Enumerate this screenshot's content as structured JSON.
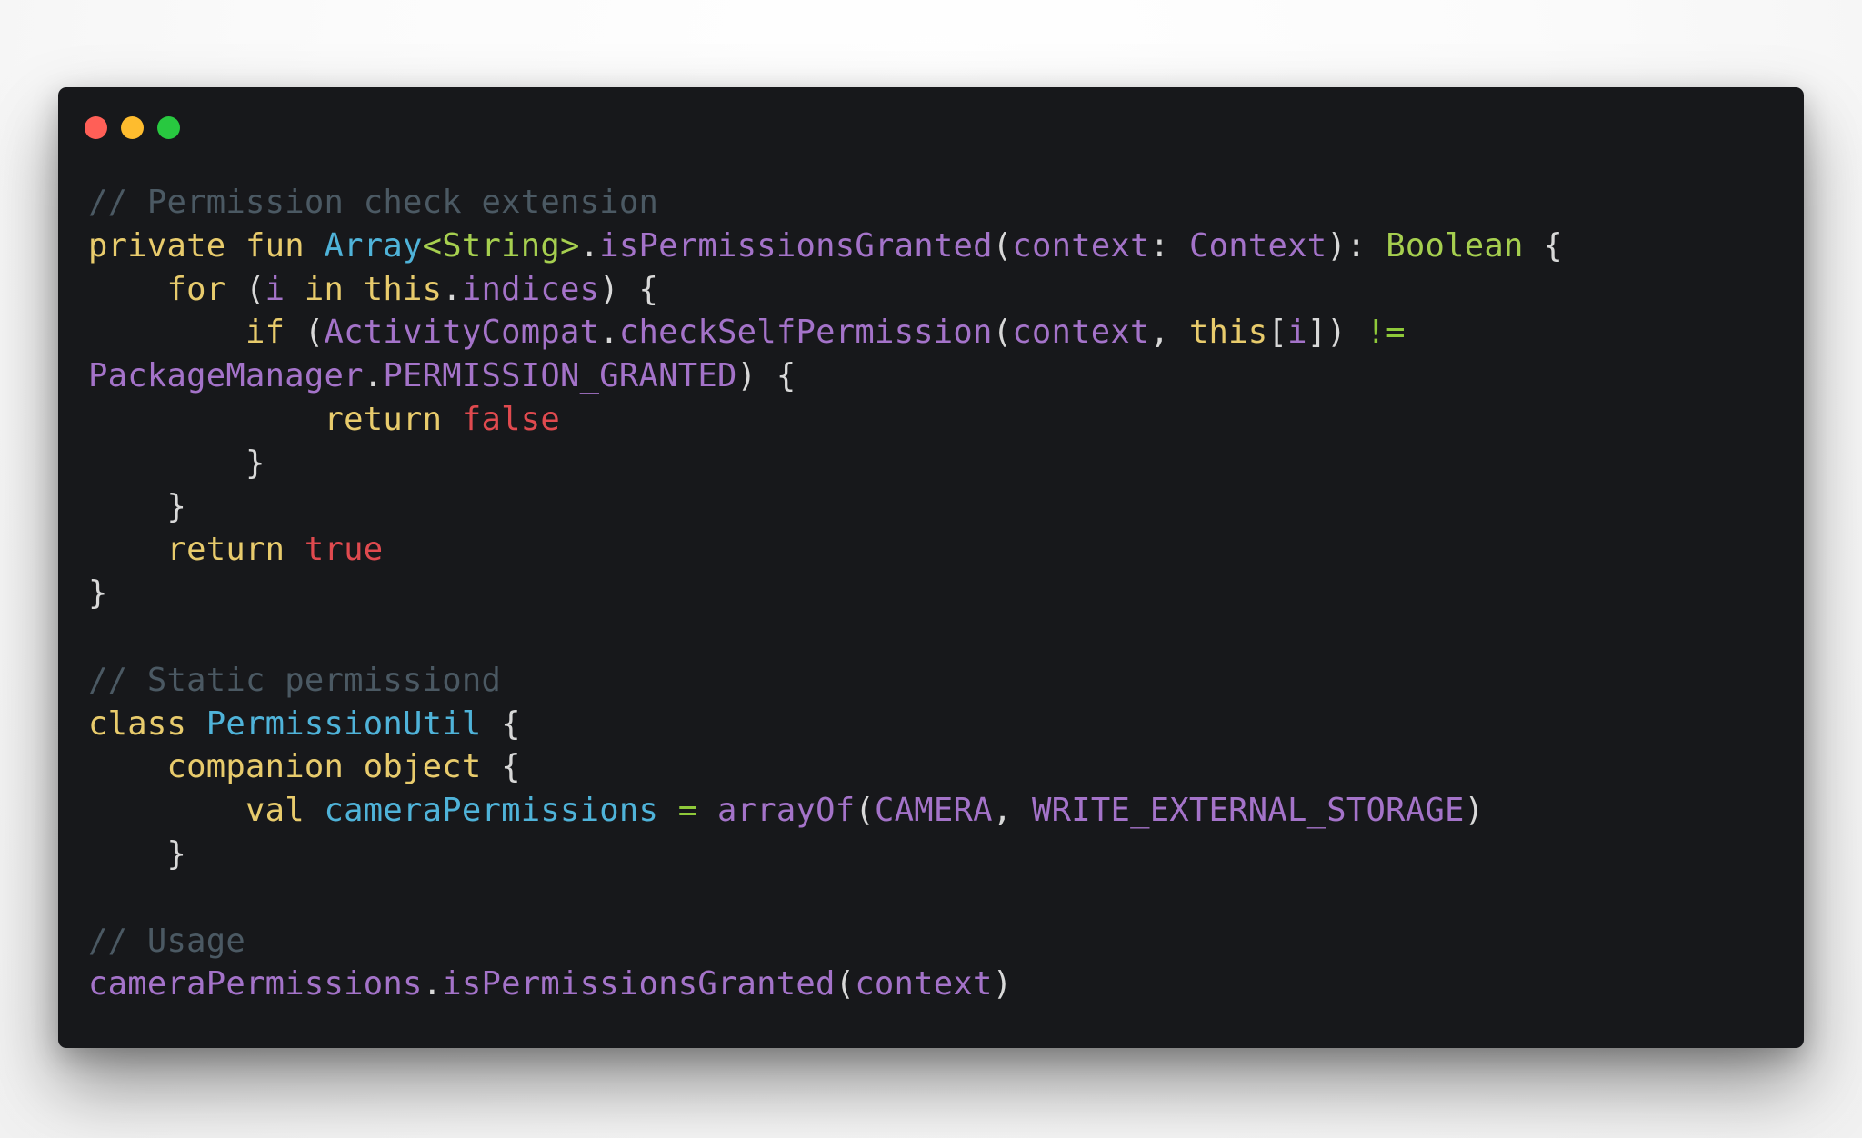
{
  "window": {
    "controls": [
      {
        "name": "close-button",
        "color": "#ff5f57"
      },
      {
        "name": "minimize-button",
        "color": "#febc2e"
      },
      {
        "name": "maximize-button",
        "color": "#28c840"
      }
    ]
  },
  "theme": {
    "background": "#17181b",
    "comment": "#4b5963",
    "keyword": "#e8cb6c",
    "type": "#4fb3d9",
    "generic": "#a6cf4f",
    "ident": "#a473c9",
    "punct": "#d8d8d8",
    "literal": "#e04a4f",
    "builtin": "#a6cf4f",
    "operator": "#8fc93a",
    "plain": "#d8d8d8"
  },
  "code": {
    "language": "Kotlin",
    "lines": [
      [
        [
          "comment",
          "// Permission check extension"
        ]
      ],
      [
        [
          "keyword",
          "private"
        ],
        [
          "plain",
          " "
        ],
        [
          "keyword",
          "fun"
        ],
        [
          "plain",
          " "
        ],
        [
          "type",
          "Array"
        ],
        [
          "generic",
          "<String>"
        ],
        [
          "punct",
          "."
        ],
        [
          "ident",
          "isPermissionsGranted"
        ],
        [
          "punct",
          "("
        ],
        [
          "ident",
          "context"
        ],
        [
          "punct",
          ": "
        ],
        [
          "ident",
          "Context"
        ],
        [
          "punct",
          "): "
        ],
        [
          "builtin",
          "Boolean"
        ],
        [
          "punct",
          " {"
        ]
      ],
      [
        [
          "plain",
          "    "
        ],
        [
          "keyword",
          "for"
        ],
        [
          "punct",
          " ("
        ],
        [
          "ident",
          "i"
        ],
        [
          "plain",
          " "
        ],
        [
          "keyword",
          "in"
        ],
        [
          "plain",
          " "
        ],
        [
          "keyword",
          "this"
        ],
        [
          "punct",
          "."
        ],
        [
          "ident",
          "indices"
        ],
        [
          "punct",
          ") {"
        ]
      ],
      [
        [
          "plain",
          "        "
        ],
        [
          "keyword",
          "if"
        ],
        [
          "punct",
          " ("
        ],
        [
          "ident",
          "ActivityCompat"
        ],
        [
          "punct",
          "."
        ],
        [
          "ident",
          "checkSelfPermission"
        ],
        [
          "punct",
          "("
        ],
        [
          "ident",
          "context"
        ],
        [
          "punct",
          ", "
        ],
        [
          "keyword",
          "this"
        ],
        [
          "punct",
          "["
        ],
        [
          "ident",
          "i"
        ],
        [
          "punct",
          "]) "
        ],
        [
          "operator",
          "!="
        ]
      ],
      [
        [
          "ident",
          "PackageManager"
        ],
        [
          "punct",
          "."
        ],
        [
          "ident",
          "PERMISSION_GRANTED"
        ],
        [
          "punct",
          ") {"
        ]
      ],
      [
        [
          "plain",
          "            "
        ],
        [
          "keyword",
          "return"
        ],
        [
          "plain",
          " "
        ],
        [
          "literal",
          "false"
        ]
      ],
      [
        [
          "plain",
          "        "
        ],
        [
          "punct",
          "}"
        ]
      ],
      [
        [
          "plain",
          "    "
        ],
        [
          "punct",
          "}"
        ]
      ],
      [
        [
          "plain",
          "    "
        ],
        [
          "keyword",
          "return"
        ],
        [
          "plain",
          " "
        ],
        [
          "literal",
          "true"
        ]
      ],
      [
        [
          "punct",
          "}"
        ]
      ],
      [],
      [
        [
          "comment",
          "// Static permissiond"
        ]
      ],
      [
        [
          "keyword",
          "class"
        ],
        [
          "plain",
          " "
        ],
        [
          "type",
          "PermissionUtil"
        ],
        [
          "punct",
          " {"
        ]
      ],
      [
        [
          "plain",
          "    "
        ],
        [
          "keyword",
          "companion"
        ],
        [
          "plain",
          " "
        ],
        [
          "keyword",
          "object"
        ],
        [
          "punct",
          " {"
        ]
      ],
      [
        [
          "plain",
          "        "
        ],
        [
          "keyword",
          "val"
        ],
        [
          "plain",
          " "
        ],
        [
          "type",
          "cameraPermissions"
        ],
        [
          "plain",
          " "
        ],
        [
          "operator",
          "="
        ],
        [
          "plain",
          " "
        ],
        [
          "ident",
          "arrayOf"
        ],
        [
          "punct",
          "("
        ],
        [
          "ident",
          "CAMERA"
        ],
        [
          "punct",
          ", "
        ],
        [
          "ident",
          "WRITE_EXTERNAL_STORAGE"
        ],
        [
          "punct",
          ")"
        ]
      ],
      [
        [
          "plain",
          "    "
        ],
        [
          "punct",
          "}"
        ]
      ],
      [],
      [
        [
          "comment",
          "// Usage"
        ]
      ],
      [
        [
          "ident",
          "cameraPermissions"
        ],
        [
          "punct",
          "."
        ],
        [
          "ident",
          "isPermissionsGranted"
        ],
        [
          "punct",
          "("
        ],
        [
          "ident",
          "context"
        ],
        [
          "punct",
          ")"
        ]
      ]
    ]
  }
}
